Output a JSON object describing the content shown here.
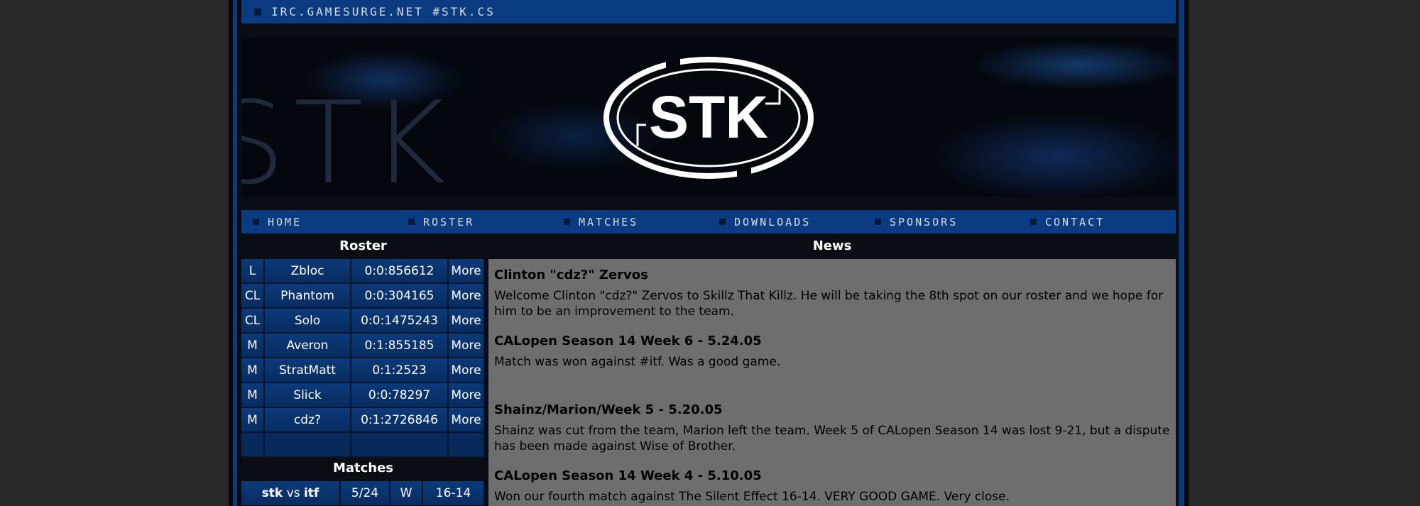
{
  "topbar": {
    "irc": "IRC.GAMESURGE.NET #STK.CS"
  },
  "banner": {
    "bg_text": "STK",
    "logo_text": "STK"
  },
  "nav": [
    "HOME",
    "ROSTER",
    "MATCHES",
    "DOWNLOADS",
    "SPONSORS",
    "CONTACT"
  ],
  "roster": {
    "heading": "Roster",
    "players": [
      {
        "role": "L",
        "name": "Zbloc",
        "id": "0:0:856612",
        "more": "More"
      },
      {
        "role": "CL",
        "name": "Phantom",
        "id": "0:0:304165",
        "more": "More"
      },
      {
        "role": "CL",
        "name": "Solo",
        "id": "0:0:1475243",
        "more": "More"
      },
      {
        "role": "M",
        "name": "Averon",
        "id": "0:1:855185",
        "more": "More"
      },
      {
        "role": "M",
        "name": "StratMatt",
        "id": "0:1:2523",
        "more": "More"
      },
      {
        "role": "M",
        "name": "Slick",
        "id": "0:0:78297",
        "more": "More"
      },
      {
        "role": "M",
        "name": "cdz?",
        "id": "0:1:2726846",
        "more": "More"
      }
    ]
  },
  "matches": {
    "heading": "Matches",
    "rows": [
      {
        "team": "stk",
        "vs": "vs",
        "opp": "itf",
        "date": "5/24",
        "result": "W",
        "score": "16-14"
      }
    ]
  },
  "news": {
    "heading": "News",
    "items": [
      {
        "title": "Clinton \"cdz?\" Zervos",
        "body": "Welcome Clinton \"cdz?\" Zervos to Skillz That Killz. He will be taking the 8th spot on our roster and we hope for him to be an improvement to the team."
      },
      {
        "title": "CALopen Season 14 Week 6 - 5.24.05",
        "body": "Match was won against #itf. Was a good game."
      },
      {
        "title": "Shainz/Marion/Week 5 - 5.20.05",
        "body": "Shainz was cut from the team, Marion left the team. Week 5 of CALopen Season 14 was lost 9-21, but a dispute has been made against Wise of Brother."
      },
      {
        "title": "CALopen Season 14 Week 4 - 5.10.05",
        "body": "Won our fourth match against The Silent Effect 16-14. VERY GOOD GAME. Very close."
      }
    ]
  },
  "colors": {
    "nav_bg": "#0b3c82",
    "news_bg": "#6e6e6e",
    "outer_bg": "#282828"
  }
}
